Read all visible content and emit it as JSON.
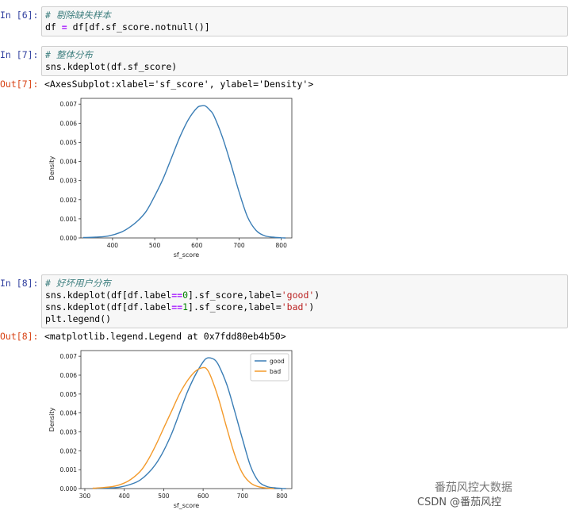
{
  "cells": [
    {
      "prompt": "In [6]:",
      "lines": [
        [
          {
            "t": "# 剔除缺失样本",
            "c": "cm"
          }
        ],
        [
          {
            "t": "df ",
            "c": ""
          },
          {
            "t": "=",
            "c": "op"
          },
          {
            "t": " df[df.sf_score.notnull()]",
            "c": ""
          }
        ]
      ]
    },
    {
      "prompt": "In [7]:",
      "lines": [
        [
          {
            "t": "# 整体分布",
            "c": "cm"
          }
        ],
        [
          {
            "t": "sns.kdeplot(df.sf_score)",
            "c": ""
          }
        ]
      ]
    },
    {
      "prompt": "In [8]:",
      "lines": [
        [
          {
            "t": "# 好坏用户分布",
            "c": "cm"
          }
        ],
        [
          {
            "t": "sns.kdeplot(df[df.label",
            "c": ""
          },
          {
            "t": "==",
            "c": "op"
          },
          {
            "t": "0",
            "c": "num"
          },
          {
            "t": "].sf_score,label=",
            "c": ""
          },
          {
            "t": "'good'",
            "c": "str"
          },
          {
            "t": ")",
            "c": ""
          }
        ],
        [
          {
            "t": "sns.kdeplot(df[df.label",
            "c": ""
          },
          {
            "t": "==",
            "c": "op"
          },
          {
            "t": "1",
            "c": "num"
          },
          {
            "t": "].sf_score,label=",
            "c": ""
          },
          {
            "t": "'bad'",
            "c": "str"
          },
          {
            "t": ")",
            "c": ""
          }
        ],
        [
          {
            "t": "plt.legend()",
            "c": ""
          }
        ]
      ]
    }
  ],
  "outputs": [
    {
      "prompt": "Out[7]:",
      "text": "<AxesSubplot:xlabel='sf_score', ylabel='Density'>"
    },
    {
      "prompt": "Out[8]:",
      "text": "<matplotlib.legend.Legend at 0x7fdd80eb4b50>"
    }
  ],
  "chart_data": [
    {
      "type": "line",
      "title": "",
      "xlabel": "sf_score",
      "ylabel": "Density",
      "xlim": [
        325,
        825
      ],
      "ylim": [
        0,
        0.0073
      ],
      "xticks": [
        400,
        500,
        600,
        700,
        800
      ],
      "xtick_labels": [
        "400",
        "500",
        "600",
        "700",
        "800"
      ],
      "yticks": [
        0.0,
        0.001,
        0.002,
        0.003,
        0.004,
        0.005,
        0.006,
        0.007
      ],
      "ytick_labels": [
        "0.000",
        "0.001",
        "0.002",
        "0.003",
        "0.004",
        "0.005",
        "0.006",
        "0.007"
      ],
      "grid": false,
      "legend": null,
      "series": [
        {
          "color": "#3a7db5",
          "x": [
            330,
            360,
            390,
            420,
            440,
            460,
            480,
            500,
            520,
            540,
            560,
            580,
            600,
            610,
            620,
            630,
            640,
            660,
            680,
            700,
            720,
            740,
            760,
            780,
            800,
            810
          ],
          "y": [
            2e-05,
            4e-05,
            0.0001,
            0.0003,
            0.00055,
            0.0009,
            0.0014,
            0.0022,
            0.0031,
            0.0042,
            0.0053,
            0.0062,
            0.0068,
            0.0069,
            0.0069,
            0.0067,
            0.0064,
            0.0053,
            0.0039,
            0.0024,
            0.0011,
            0.0004,
            0.00012,
            4e-05,
            1e-05,
            0.0
          ]
        }
      ]
    },
    {
      "type": "line",
      "title": "",
      "xlabel": "sf_score",
      "ylabel": "Density",
      "xlim": [
        290,
        825
      ],
      "ylim": [
        0,
        0.0073
      ],
      "xticks": [
        300,
        400,
        500,
        600,
        700,
        800
      ],
      "xtick_labels": [
        "300",
        "400",
        "500",
        "600",
        "700",
        "800"
      ],
      "yticks": [
        0.0,
        0.001,
        0.002,
        0.003,
        0.004,
        0.005,
        0.006,
        0.007
      ],
      "ytick_labels": [
        "0.000",
        "0.001",
        "0.002",
        "0.003",
        "0.004",
        "0.005",
        "0.006",
        "0.007"
      ],
      "grid": false,
      "legend": "top-right",
      "series": [
        {
          "name": "good",
          "color": "#3a7db5",
          "x": [
            330,
            360,
            390,
            420,
            440,
            460,
            480,
            500,
            520,
            540,
            560,
            580,
            600,
            610,
            620,
            630,
            640,
            660,
            680,
            700,
            720,
            740,
            760,
            780,
            800,
            810
          ],
          "y": [
            1e-05,
            3e-05,
            8e-05,
            0.00025,
            0.00045,
            0.0008,
            0.0013,
            0.002,
            0.0029,
            0.004,
            0.0051,
            0.006,
            0.0067,
            0.0069,
            0.0069,
            0.0068,
            0.0065,
            0.0055,
            0.0041,
            0.0026,
            0.0012,
            0.0004,
            0.00012,
            4e-05,
            1e-05,
            0.0
          ]
        },
        {
          "name": "bad",
          "color": "#f39a2b",
          "x": [
            320,
            350,
            380,
            410,
            440,
            460,
            480,
            500,
            520,
            540,
            560,
            580,
            600,
            610,
            620,
            640,
            660,
            680,
            700,
            720,
            740,
            760,
            780
          ],
          "y": [
            2e-05,
            6e-05,
            0.00015,
            0.0004,
            0.0009,
            0.0015,
            0.0023,
            0.0032,
            0.0041,
            0.005,
            0.0057,
            0.0062,
            0.0064,
            0.0063,
            0.0059,
            0.0047,
            0.0032,
            0.0018,
            0.0008,
            0.0003,
            0.0001,
            3e-05,
            0.0
          ]
        }
      ]
    }
  ],
  "watermark": {
    "line1": "番茄风控大数据",
    "line2": "CSDN @番茄风控"
  }
}
